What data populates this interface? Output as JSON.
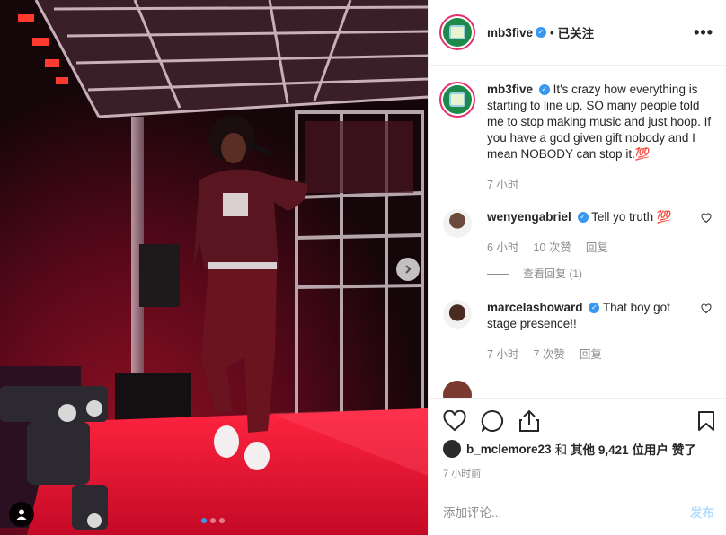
{
  "post": {
    "photo": {
      "alt": "",
      "slide_count": 3,
      "active_slide": 0
    },
    "header": {
      "username": "mb3five",
      "separator": "•",
      "follow_status": "已关注",
      "more_glyph": "•••"
    },
    "caption": {
      "username": "mb3five",
      "text": "It's crazy how everything is starting to line up. SO many people told me to stop making music and just hoop. If you have a god given gift nobody and I mean NOBODY can stop it.💯",
      "time": "7 小时"
    },
    "comments": [
      {
        "username": "wenyengabriel",
        "text": "Tell yo truth 💯",
        "time": "6 小时",
        "likes": "10 次赞",
        "reply": "回复",
        "view_replies": "查看回复 (1)"
      },
      {
        "username": "marcelashoward",
        "text": "That boy got stage presence!!",
        "time": "7 小时",
        "likes": "7 次赞",
        "reply": "回复"
      }
    ],
    "liked_by": {
      "username": "b_mclemore23",
      "connector": "和",
      "others": "其他 9,421 位用户",
      "suffix": "赞了"
    },
    "timestamp": "7 小时前",
    "add_comment": {
      "placeholder": "添加评论...",
      "post_label": "发布"
    },
    "colors": {
      "accent": "#3897f0",
      "post_disabled": "#b2dffc",
      "muted": "#8e8e8e",
      "stage_red": "#e0102a"
    },
    "icons": [
      "heart-icon",
      "comment-icon",
      "share-icon",
      "bookmark-icon",
      "chevron-right-icon",
      "user-tag-icon",
      "more-icon",
      "verified-icon"
    ]
  }
}
